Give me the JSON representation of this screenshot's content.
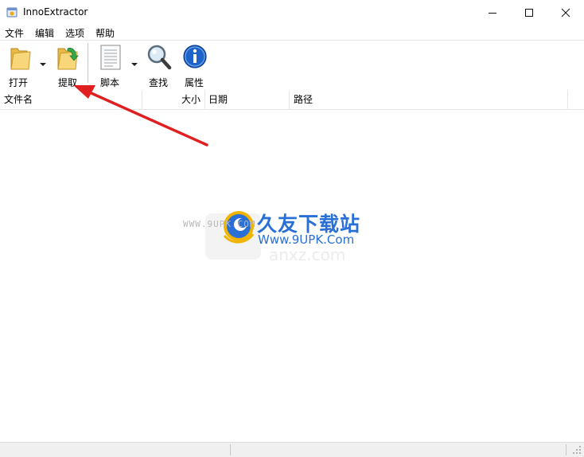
{
  "window": {
    "title": "InnoExtractor"
  },
  "menu": {
    "file": "文件",
    "edit": "编辑",
    "options": "选项",
    "help": "帮助"
  },
  "toolbar": {
    "open": "打开",
    "extract": "提取",
    "script": "脚本",
    "find": "查找",
    "properties": "属性"
  },
  "columns": {
    "filename": "文件名",
    "size": "大小",
    "date": "日期",
    "path": "路径"
  },
  "watermark": {
    "brand": "久友下载站",
    "url": "Www.9UPK.Com",
    "left_text": "WWW.9UPK.COM",
    "ghost_text": "anxz.com"
  },
  "colors": {
    "arrow": "#e02020",
    "watermark_blue": "#2a6fd6",
    "watermark_gold": "#f0b400"
  }
}
